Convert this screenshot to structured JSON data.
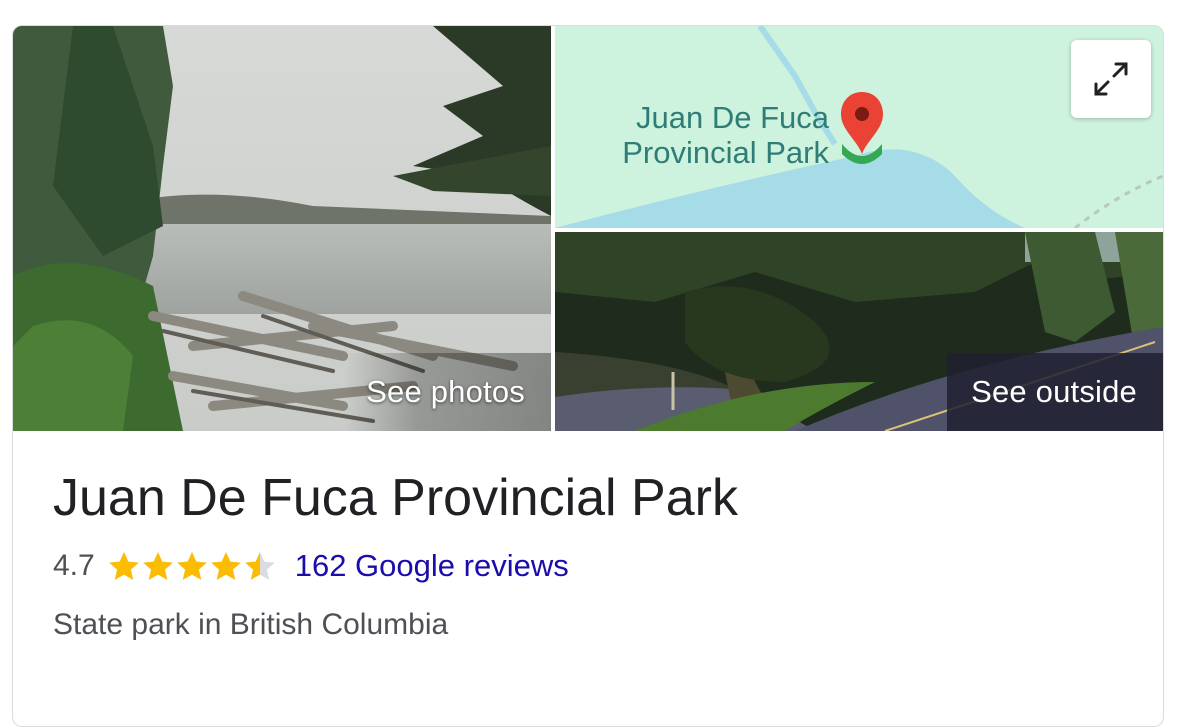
{
  "media": {
    "photos_label": "See photos",
    "outside_label": "See outside",
    "map": {
      "place_line1": "Juan De Fuca",
      "place_line2": "Provincial Park",
      "pin_icon": "map-pin-icon",
      "expand_icon": "expand-icon"
    }
  },
  "place": {
    "name": "Juan De Fuca Provincial Park",
    "rating": "4.7",
    "rating_fraction": 0.94,
    "stars_filled": 4.5,
    "reviews_label": "162 Google reviews",
    "category": "State park in British Columbia"
  },
  "colors": {
    "star": "#fbbc04",
    "star_empty": "#dadce0",
    "link": "#1a0dab",
    "map_land": "#cdf2dd",
    "map_water": "#a6dbe8",
    "pin": "#ea4335"
  }
}
